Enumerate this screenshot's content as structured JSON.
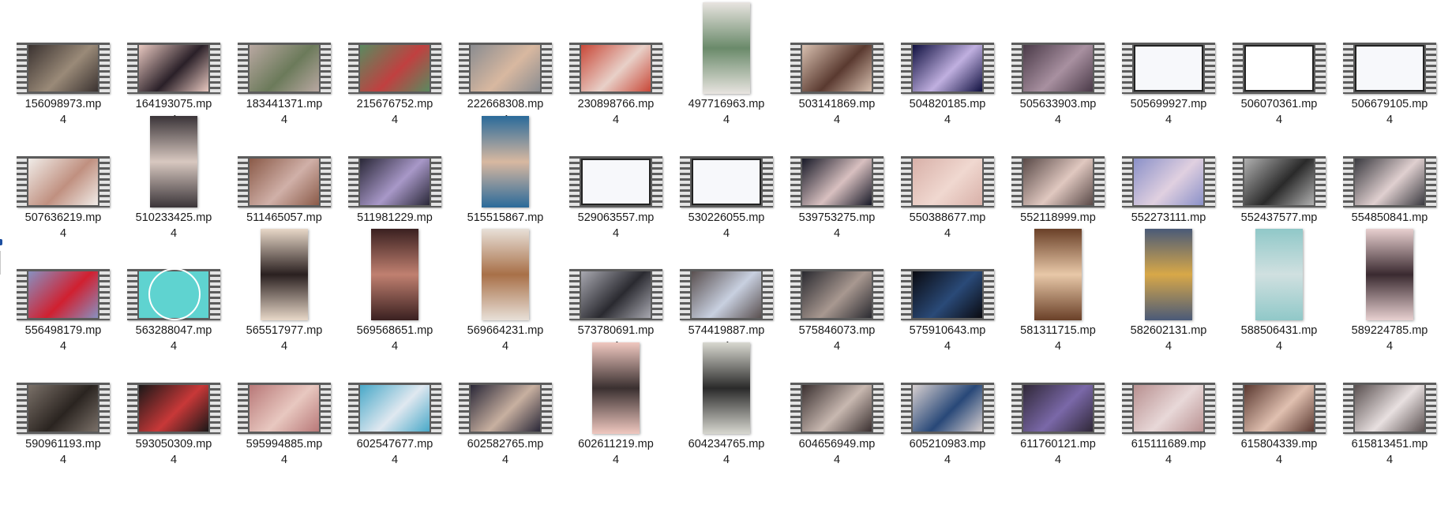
{
  "explorer": {
    "icon_name": "video-file-icon",
    "files": [
      {
        "name_line1": "156098973.mp",
        "name_line2": "4",
        "thumb": "film",
        "colors": [
          "#3a3230",
          "#9a8a78"
        ]
      },
      {
        "name_line1": "164193075.mp",
        "name_line2": "4",
        "thumb": "film",
        "colors": [
          "#e8c8c0",
          "#2a2028"
        ]
      },
      {
        "name_line1": "183441371.mp",
        "name_line2": "4",
        "thumb": "film",
        "colors": [
          "#b9a8a2",
          "#6b7a5a"
        ]
      },
      {
        "name_line1": "215676752.mp",
        "name_line2": "4",
        "thumb": "film",
        "colors": [
          "#5a8a60",
          "#c04040"
        ]
      },
      {
        "name_line1": "222668308.mp",
        "name_line2": "4",
        "thumb": "film",
        "colors": [
          "#8a8c90",
          "#d8b8a0"
        ]
      },
      {
        "name_line1": "230898766.mp",
        "name_line2": "4",
        "thumb": "film",
        "colors": [
          "#c84838",
          "#e8d0c8"
        ]
      },
      {
        "name_line1": "497716963.mp",
        "name_line2": "4",
        "thumb": "portrait",
        "colors": [
          "#e8e4e0",
          "#6a8a6a"
        ]
      },
      {
        "name_line1": "503141869.mp",
        "name_line2": "4",
        "thumb": "film",
        "colors": [
          "#d8c0b0",
          "#5a3a30"
        ]
      },
      {
        "name_line1": "504820185.mp",
        "name_line2": "4",
        "thumb": "film",
        "colors": [
          "#101040",
          "#c0b0e0"
        ]
      },
      {
        "name_line1": "505633903.mp",
        "name_line2": "4",
        "thumb": "film",
        "colors": [
          "#4a3a48",
          "#a890a0"
        ]
      },
      {
        "name_line1": "505699927.mp",
        "name_line2": "4",
        "thumb": "blank",
        "colors": [
          "#f7f8fb",
          "#f7f8fb"
        ]
      },
      {
        "name_line1": "506070361.mp",
        "name_line2": "4",
        "thumb": "blank2",
        "colors": [
          "#ffffff",
          "#ffffff"
        ]
      },
      {
        "name_line1": "506679105.mp",
        "name_line2": "4",
        "thumb": "blank",
        "colors": [
          "#f7f8fb",
          "#f7f8fb"
        ]
      },
      {
        "name_line1": "507636219.mp",
        "name_line2": "4",
        "thumb": "film",
        "colors": [
          "#f0ece8",
          "#c09080"
        ]
      },
      {
        "name_line1": "510233425.mp",
        "name_line2": "4",
        "thumb": "portrait",
        "colors": [
          "#3a3438",
          "#d8c8c0"
        ]
      },
      {
        "name_line1": "511465057.mp",
        "name_line2": "4",
        "thumb": "film",
        "colors": [
          "#8a5a48",
          "#d0b0a8"
        ]
      },
      {
        "name_line1": "511981229.mp",
        "name_line2": "4",
        "thumb": "film",
        "colors": [
          "#2a2838",
          "#a898c8"
        ]
      },
      {
        "name_line1": "515515867.mp",
        "name_line2": "4",
        "thumb": "portrait",
        "colors": [
          "#2a6a9a",
          "#d8b8a0"
        ]
      },
      {
        "name_line1": "529063557.mp",
        "name_line2": "4",
        "thumb": "blank",
        "colors": [
          "#f7f8fb",
          "#f7f8fb"
        ]
      },
      {
        "name_line1": "530226055.mp",
        "name_line2": "4",
        "thumb": "blank",
        "colors": [
          "#f7f8fb",
          "#f7f8fb"
        ]
      },
      {
        "name_line1": "539753275.mp",
        "name_line2": "4",
        "thumb": "film",
        "colors": [
          "#181a28",
          "#d8c0c0"
        ]
      },
      {
        "name_line1": "550388677.mp",
        "name_line2": "4",
        "thumb": "film",
        "colors": [
          "#d8b0a8",
          "#f0d8d0"
        ]
      },
      {
        "name_line1": "552118999.mp",
        "name_line2": "4",
        "thumb": "film",
        "colors": [
          "#5a4a48",
          "#e0c8c0"
        ]
      },
      {
        "name_line1": "552273111.mp",
        "name_line2": "4",
        "thumb": "film",
        "colors": [
          "#8a90c8",
          "#e0d0e0"
        ]
      },
      {
        "name_line1": "552437577.mp",
        "name_line2": "4",
        "thumb": "film",
        "colors": [
          "#b0b0b0",
          "#2a2a2a"
        ]
      },
      {
        "name_line1": "554850841.mp",
        "name_line2": "4",
        "thumb": "film",
        "colors": [
          "#3a3a40",
          "#e0d0d0"
        ]
      },
      {
        "name_line1": "556498179.mp",
        "name_line2": "4",
        "thumb": "film",
        "colors": [
          "#8890c0",
          "#d02030"
        ]
      },
      {
        "name_line1": "563288047.mp",
        "name_line2": "4",
        "thumb": "teal",
        "colors": [
          "#5fd3d0",
          "#5fd3d0"
        ]
      },
      {
        "name_line1": "565517977.mp",
        "name_line2": "4",
        "thumb": "portrait",
        "colors": [
          "#e8d8c8",
          "#2a2020"
        ]
      },
      {
        "name_line1": "569568651.mp",
        "name_line2": "4",
        "thumb": "portrait",
        "colors": [
          "#3a2020",
          "#c08070"
        ]
      },
      {
        "name_line1": "569664231.mp",
        "name_line2": "4",
        "thumb": "portrait",
        "colors": [
          "#e8e0d8",
          "#a87048"
        ]
      },
      {
        "name_line1": "573780691.mp",
        "name_line2": "4",
        "thumb": "film",
        "colors": [
          "#a8a8b0",
          "#2a2a30"
        ]
      },
      {
        "name_line1": "574419887.mp",
        "name_line2": "4",
        "thumb": "film",
        "colors": [
          "#5a5050",
          "#c8d0e0"
        ]
      },
      {
        "name_line1": "575846073.mp",
        "name_line2": "4",
        "thumb": "film",
        "colors": [
          "#2a2a30",
          "#a89890"
        ]
      },
      {
        "name_line1": "575910643.mp",
        "name_line2": "4",
        "thumb": "film",
        "colors": [
          "#0a0a10",
          "#2a4a78"
        ]
      },
      {
        "name_line1": "581311715.mp",
        "name_line2": "4",
        "thumb": "portrait",
        "colors": [
          "#6a4028",
          "#e8c8a8"
        ]
      },
      {
        "name_line1": "582602131.mp",
        "name_line2": "4",
        "thumb": "portrait",
        "colors": [
          "#4a5a78",
          "#d8a848"
        ]
      },
      {
        "name_line1": "588506431.mp",
        "name_line2": "4",
        "thumb": "portrait",
        "colors": [
          "#90c8c8",
          "#d0e0e0"
        ]
      },
      {
        "name_line1": "589224785.mp",
        "name_line2": "4",
        "thumb": "portrait",
        "colors": [
          "#e8d0d0",
          "#3a2a30"
        ]
      },
      {
        "name_line1": "590961193.mp",
        "name_line2": "4",
        "thumb": "film",
        "colors": [
          "#7a7068",
          "#2a2420"
        ]
      },
      {
        "name_line1": "593050309.mp",
        "name_line2": "4",
        "thumb": "film",
        "colors": [
          "#1a1818",
          "#c83838"
        ]
      },
      {
        "name_line1": "595994885.mp",
        "name_line2": "4",
        "thumb": "film",
        "colors": [
          "#b87878",
          "#e8c8c0"
        ]
      },
      {
        "name_line1": "602547677.mp",
        "name_line2": "4",
        "thumb": "film",
        "colors": [
          "#48a8c8",
          "#e0e8f0"
        ]
      },
      {
        "name_line1": "602582765.mp",
        "name_line2": "4",
        "thumb": "film",
        "colors": [
          "#2a2838",
          "#c8b0a0"
        ]
      },
      {
        "name_line1": "602611219.mp",
        "name_line2": "4",
        "thumb": "portrait",
        "colors": [
          "#f0c8c0",
          "#3a3030"
        ]
      },
      {
        "name_line1": "604234765.mp",
        "name_line2": "4",
        "thumb": "portrait",
        "colors": [
          "#d8d8d0",
          "#2a2a2a"
        ]
      },
      {
        "name_line1": "604656949.mp",
        "name_line2": "4",
        "thumb": "film",
        "colors": [
          "#3a3030",
          "#c8b8b0"
        ]
      },
      {
        "name_line1": "605210983.mp",
        "name_line2": "4",
        "thumb": "film",
        "colors": [
          "#d8d0d0",
          "#284878"
        ]
      },
      {
        "name_line1": "611760121.mp",
        "name_line2": "4",
        "thumb": "film",
        "colors": [
          "#302838",
          "#7a68a8"
        ]
      },
      {
        "name_line1": "615111689.mp",
        "name_line2": "4",
        "thumb": "film",
        "colors": [
          "#b89090",
          "#e8d8d8"
        ]
      },
      {
        "name_line1": "615804339.mp",
        "name_line2": "4",
        "thumb": "film",
        "colors": [
          "#5a3830",
          "#e0c0b0"
        ]
      },
      {
        "name_line1": "615813451.mp",
        "name_line2": "4",
        "thumb": "film",
        "colors": [
          "#5a5050",
          "#e8e0e0"
        ]
      }
    ]
  }
}
